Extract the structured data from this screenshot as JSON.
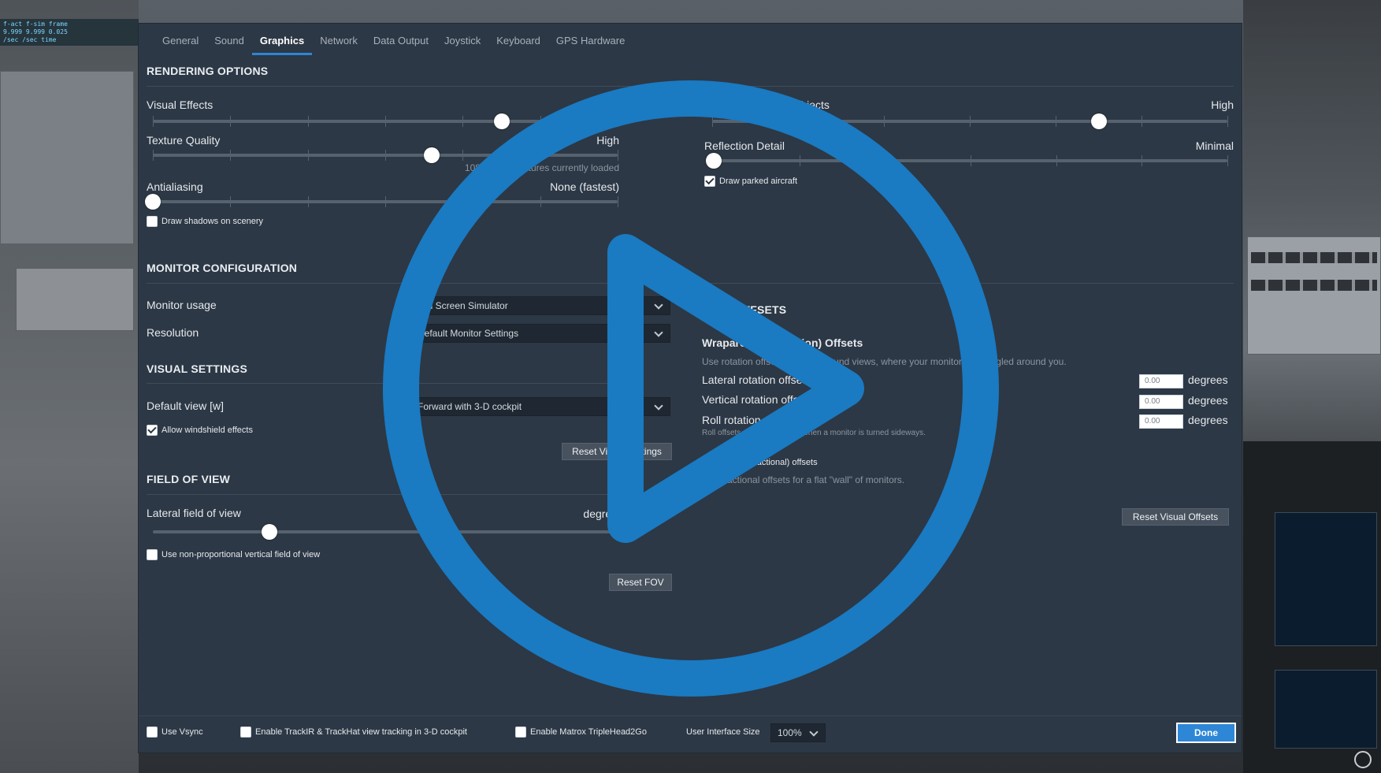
{
  "hud": {
    "line1": "f-act  f-sim  frame",
    "line2": "9.999  9.999  0.025",
    "line3": "/sec   /sec   time"
  },
  "tabs": [
    {
      "label": "General"
    },
    {
      "label": "Sound"
    },
    {
      "label": "Graphics",
      "active": true
    },
    {
      "label": "Network"
    },
    {
      "label": "Data Output"
    },
    {
      "label": "Joystick"
    },
    {
      "label": "Keyboard"
    },
    {
      "label": "GPS Hardware"
    }
  ],
  "rendering": {
    "title": "RENDERING OPTIONS",
    "visual_effects": {
      "label": "Visual Effects",
      "value": "(HDR)",
      "level": 0.75
    },
    "texture_quality": {
      "label": "Texture Quality",
      "value": "High",
      "level": 0.6,
      "note": "1084 MB of textures currently loaded"
    },
    "antialiasing": {
      "label": "Antialiasing",
      "value": "None (fastest)",
      "level": 0.0
    },
    "draw_shadows": {
      "label": "Draw shadows on scenery",
      "checked": false
    },
    "number_objects": {
      "label": "Number of World Objects",
      "value": "High",
      "level": 0.75
    },
    "reflection_detail": {
      "label": "Reflection Detail",
      "value": "Minimal",
      "level": 0.0
    },
    "draw_parked": {
      "label": "Draw parked aircraft",
      "checked": true
    }
  },
  "monitor": {
    "title": "MONITOR CONFIGURATION",
    "usage_label": "Monitor usage",
    "usage_value": "Full Screen Simulator",
    "resolution_label": "Resolution",
    "resolution_value": "Default Monitor Settings"
  },
  "visual_settings": {
    "title": "VISUAL SETTINGS",
    "default_view_label": "Default view [w]",
    "default_view_value": "Forward with 3-D cockpit",
    "windshield": {
      "label": "Allow windshield effects",
      "checked": true
    },
    "reset_label": "Reset Visual Settings"
  },
  "fov": {
    "title": "FIELD OF VIEW",
    "lateral_label": "Lateral field of view",
    "lateral_unit": "degrees",
    "level": 0.25,
    "nonprop": {
      "label": "Use non-proportional vertical field of view",
      "checked": false
    },
    "reset_label": "Reset FOV"
  },
  "offsets": {
    "title": "VISUAL OFFSETS",
    "wrap_title": "Wraparound (Rotation) Offsets",
    "wrap_note": "Use rotation offsets for wraparound views, where your monitors are angled around you.",
    "lateral_label": "Lateral rotation offset",
    "vertical_label": "Vertical rotation offset",
    "roll_label": "Roll rotation offset",
    "roll_note": "Roll offsets are usually used when a monitor is turned sideways.",
    "lateral_value": "0.00",
    "vertical_value": "0.00",
    "roll_value": "0.00",
    "unit": "degrees",
    "flat": {
      "label": "Use flat (fractional) offsets",
      "checked": false
    },
    "flat_note": "Use fractional offsets for a flat \"wall\" of monitors.",
    "reset_label": "Reset Visual Offsets"
  },
  "footer": {
    "vsync": {
      "label": "Use Vsync",
      "checked": false
    },
    "trackir": {
      "label": "Enable TrackIR & TrackHat view tracking in 3-D cockpit",
      "checked": false
    },
    "matrox": {
      "label": "Enable Matrox TripleHead2Go",
      "checked": false
    },
    "ui_size_label": "User Interface Size",
    "ui_size_value": "100%",
    "done_label": "Done"
  },
  "overlay": {
    "accent": "#1a7ac2"
  }
}
